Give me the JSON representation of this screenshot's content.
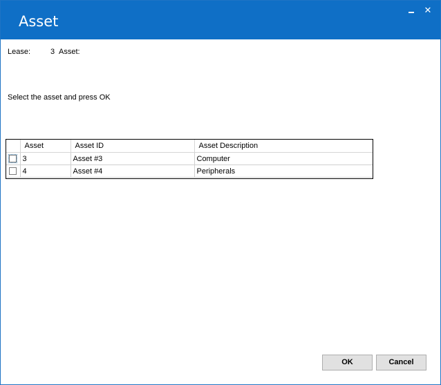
{
  "window": {
    "title": "Asset",
    "close_glyph": "✕",
    "minimize_icon": "minimize-icon",
    "close_icon": "close-icon",
    "accent_color": "#0f6fc6"
  },
  "lease": {
    "label": "Lease:",
    "value": "3",
    "asset_label": "Asset:"
  },
  "instruction": "Select the asset and press OK",
  "grid": {
    "columns": [
      "Asset",
      "Asset ID",
      "Asset Description"
    ],
    "rows": [
      {
        "asset": "3",
        "asset_id": "Asset #3",
        "description": "Computer"
      },
      {
        "asset": "4",
        "asset_id": "Asset #4",
        "description": "Peripherals"
      }
    ]
  },
  "buttons": {
    "ok": "OK",
    "cancel": "Cancel"
  }
}
